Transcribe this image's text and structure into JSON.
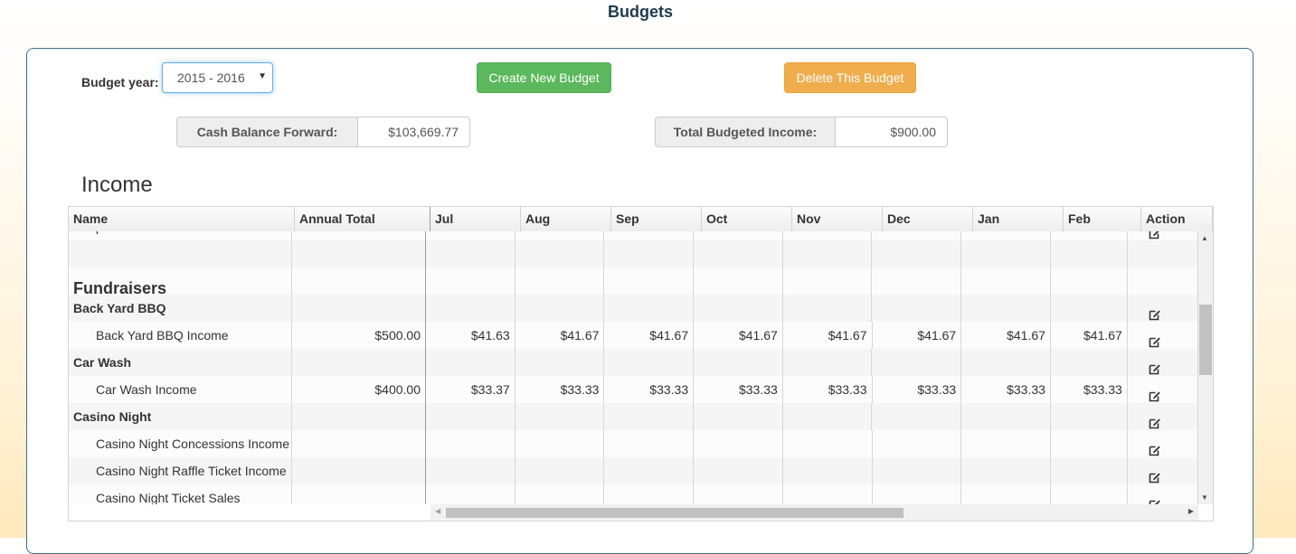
{
  "page": {
    "title": "Budgets"
  },
  "controls": {
    "budget_year_label": "Budget year:",
    "budget_year_selected": "2015 - 2016",
    "create_button": "Create New Budget",
    "delete_button": "Delete This Budget",
    "cash_balance_label": "Cash Balance Forward:",
    "cash_balance_value": "$103,669.77",
    "total_income_label": "Total Budgeted Income:",
    "total_income_value": "$900.00"
  },
  "income": {
    "title": "Income",
    "columns": [
      "Name",
      "Annual Total",
      "Jul",
      "Aug",
      "Sep",
      "Oct",
      "Nov",
      "Dec",
      "Jan",
      "Feb",
      "Action"
    ],
    "rows": [
      {
        "type": "item-flat",
        "name": "SnapRaise",
        "annual": "",
        "months": [
          "",
          "",
          "",
          "",
          "",
          "",
          "",
          ""
        ],
        "action": true
      },
      {
        "type": "blank",
        "name": "",
        "annual": "",
        "months": [
          "",
          "",
          "",
          "",
          "",
          "",
          "",
          ""
        ],
        "action": false
      },
      {
        "type": "section",
        "name": "Fundraisers",
        "annual": "",
        "months": [
          "",
          "",
          "",
          "",
          "",
          "",
          "",
          ""
        ],
        "action": false
      },
      {
        "type": "group",
        "name": "Back Yard BBQ",
        "annual": "",
        "months": [
          "",
          "",
          "",
          "",
          "",
          "",
          "",
          ""
        ],
        "action": true
      },
      {
        "type": "item",
        "name": "Back Yard BBQ Income",
        "annual": "$500.00",
        "months": [
          "$41.63",
          "$41.67",
          "$41.67",
          "$41.67",
          "$41.67",
          "$41.67",
          "$41.67",
          "$41.67"
        ],
        "action": true
      },
      {
        "type": "group",
        "name": "Car Wash",
        "annual": "",
        "months": [
          "",
          "",
          "",
          "",
          "",
          "",
          "",
          ""
        ],
        "action": true
      },
      {
        "type": "item",
        "name": "Car Wash Income",
        "annual": "$400.00",
        "months": [
          "$33.37",
          "$33.33",
          "$33.33",
          "$33.33",
          "$33.33",
          "$33.33",
          "$33.33",
          "$33.33"
        ],
        "action": true
      },
      {
        "type": "group",
        "name": "Casino Night",
        "annual": "",
        "months": [
          "",
          "",
          "",
          "",
          "",
          "",
          "",
          ""
        ],
        "action": true
      },
      {
        "type": "item",
        "name": "Casino Night Concessions Income",
        "annual": "",
        "months": [
          "",
          "",
          "",
          "",
          "",
          "",
          "",
          ""
        ],
        "action": true
      },
      {
        "type": "item",
        "name": "Casino Night Raffle Ticket Income",
        "annual": "",
        "months": [
          "",
          "",
          "",
          "",
          "",
          "",
          "",
          ""
        ],
        "action": true
      },
      {
        "type": "item",
        "name": "Casino Night Ticket Sales",
        "annual": "",
        "months": [
          "",
          "",
          "",
          "",
          "",
          "",
          "",
          ""
        ],
        "action": true
      }
    ]
  },
  "icons": {
    "edit": "edit-icon",
    "select_caret": "caret-down-icon"
  }
}
